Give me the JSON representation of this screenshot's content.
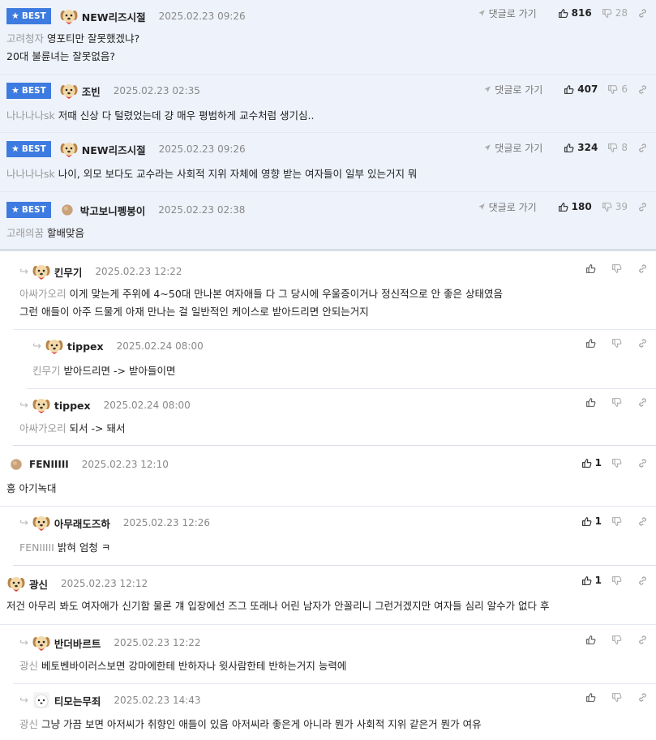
{
  "common": {
    "best_label": "BEST",
    "goto_label": "댓글로 가기"
  },
  "comments": [
    {
      "nick": "NEW리즈시절",
      "date": "2025.02.23 09:26",
      "up": "816",
      "down": "28",
      "target": "고려청자",
      "lines": [
        "영포티만 잘못했겠냐?",
        "20대 불륜녀는 잘못없음?"
      ]
    },
    {
      "nick": "조빈",
      "date": "2025.02.23 02:35",
      "up": "407",
      "down": "6",
      "target": "나나나나sk",
      "lines": [
        "저때 신상 다 털렸었는데 걍 매우 평범하게 교수처럼 생기심.."
      ]
    },
    {
      "nick": "NEW리즈시절",
      "date": "2025.02.23 09:26",
      "up": "324",
      "down": "8",
      "target": "나나나나sk",
      "lines": [
        "나이, 외모 보다도 교수라는 사회적 지위 자체에 영향 받는 여자들이 일부 있는거지 뭐"
      ]
    },
    {
      "nick": "박고보니펭붕이",
      "date": "2025.02.23 02:38",
      "up": "180",
      "down": "39",
      "target": "고래의꿈",
      "lines": [
        "할배맞음"
      ]
    },
    {
      "nick": "킨무기",
      "date": "2025.02.23 12:22",
      "target": "아싸가오리",
      "lines": [
        "이게 맞는게 주위에 4~50대 만나본 여자애들 다 그 당시에 우울증이거나 정신적으로 안 좋은 상태였음",
        "그런 애들이 아주 드물게 아재 만나는 걸 일반적인 케이스로 받아드리면 안되는거지"
      ]
    },
    {
      "nick": "tippex",
      "date": "2025.02.24 08:00",
      "target": "킨무기",
      "lines": [
        "받아드리면 -> 받아들이면"
      ]
    },
    {
      "nick": "tippex",
      "date": "2025.02.24 08:00",
      "target": "아싸가오리",
      "lines": [
        "되서 -> 돼서"
      ]
    },
    {
      "nick": "FENIIIII",
      "date": "2025.02.23 12:10",
      "up": "1",
      "target": "",
      "lines": [
        "흥 아기녹대"
      ]
    },
    {
      "nick": "아무래도즈하",
      "date": "2025.02.23 12:26",
      "up": "1",
      "target": "FENIIIII",
      "lines": [
        "밝혀 엄청 ㅋ"
      ]
    },
    {
      "nick": "광신",
      "date": "2025.02.23 12:12",
      "up": "1",
      "target": "",
      "lines": [
        "저건 아무리 봐도 여자애가 신기함 물론 걔 입장에선 즈그 또래나 어린 남자가 안꼴리니 그런거겠지만 여자들 심리 알수가 없다 후"
      ]
    },
    {
      "nick": "반더바르트",
      "date": "2025.02.23 12:22",
      "target": "광신",
      "lines": [
        "베토벤바이러스보면 강마에한테 반하자나 윗사람한테 반하는거지 능력에"
      ]
    },
    {
      "nick": "티모는무죄",
      "date": "2025.02.23 14:43",
      "target": "광신",
      "lines": [
        "그냥 가끔 보면 아저씨가 취향인 애들이 있음 아저씨라 좋은게 아니라 뭔가 사회적 지위 같은거 뭔가 여유"
      ]
    }
  ]
}
